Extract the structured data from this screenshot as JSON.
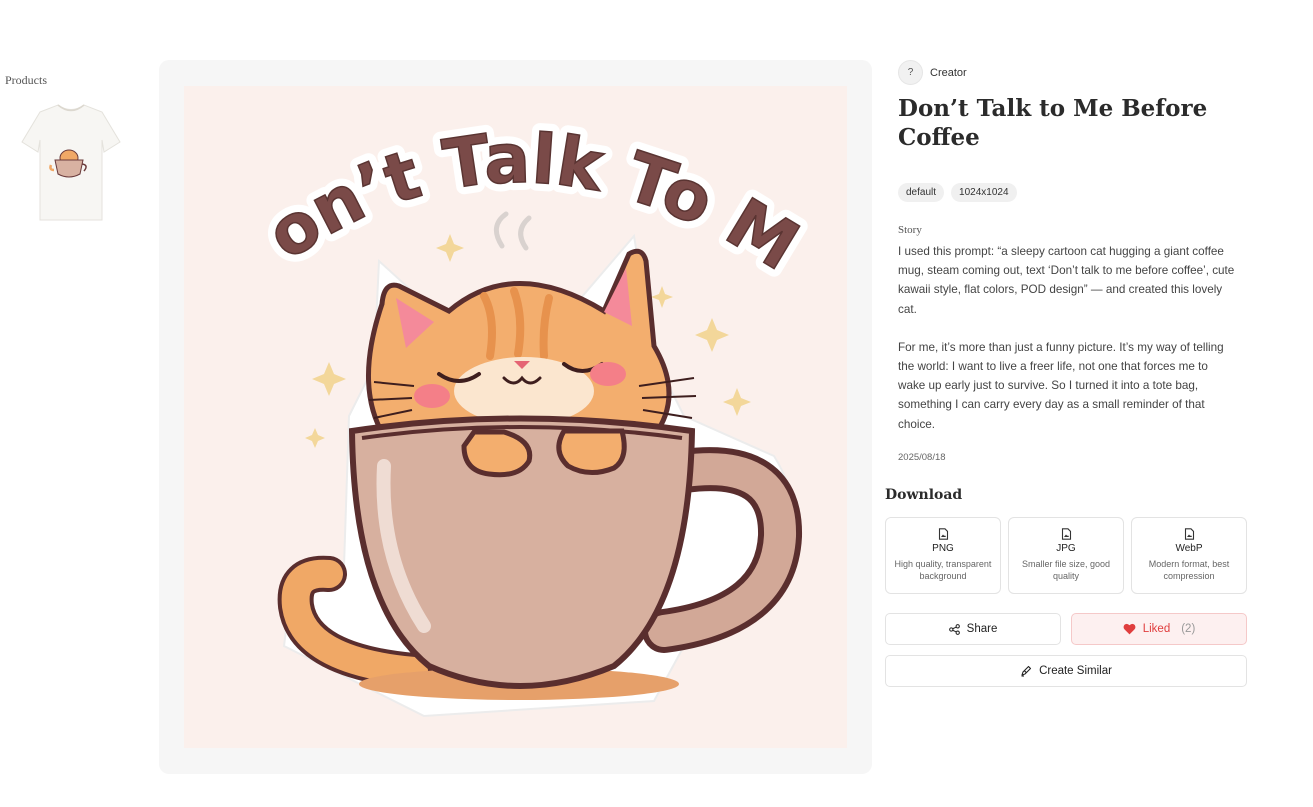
{
  "sidebar": {
    "products_label": "Products"
  },
  "artwork": {
    "headline": "Don’t Talk To Me"
  },
  "creator": {
    "avatar_text": "?",
    "name": "Creator"
  },
  "title": "Don’t Talk to Me Before Coffee",
  "tags": [
    "default",
    "1024x1024"
  ],
  "story": {
    "label": "Story",
    "paragraphs": [
      "I used this prompt: “a sleepy cartoon cat hugging a giant coffee mug, steam coming out, text ‘Don’t talk to me before coffee’, cute kawaii style, flat colors, POD design” — and created this lovely cat.",
      "For me, it’s more than just a funny picture. It’s my way of telling the world: I want to live a freer life, not one that forces me to wake up early just to survive. So I turned it into a tote bag, something I can carry every day as a small reminder of that choice."
    ],
    "date": "2025/08/18"
  },
  "download": {
    "heading": "Download",
    "formats": [
      {
        "name": "PNG",
        "desc": "High quality, transparent background",
        "icon": "file-image-icon"
      },
      {
        "name": "JPG",
        "desc": "Smaller file size, good quality",
        "icon": "file-image-icon"
      },
      {
        "name": "WebP",
        "desc": "Modern format, best compression",
        "icon": "file-image-icon"
      }
    ]
  },
  "actions": {
    "share_label": "Share",
    "liked_label": "Liked",
    "liked_count": "(2)",
    "create_similar_label": "Create Similar"
  },
  "colors": {
    "liked": "#e03e3e",
    "liked_bg": "#fdf0f0",
    "panel_bg": "#f6f6f6",
    "artwork_bg": "#fbf0ec"
  }
}
